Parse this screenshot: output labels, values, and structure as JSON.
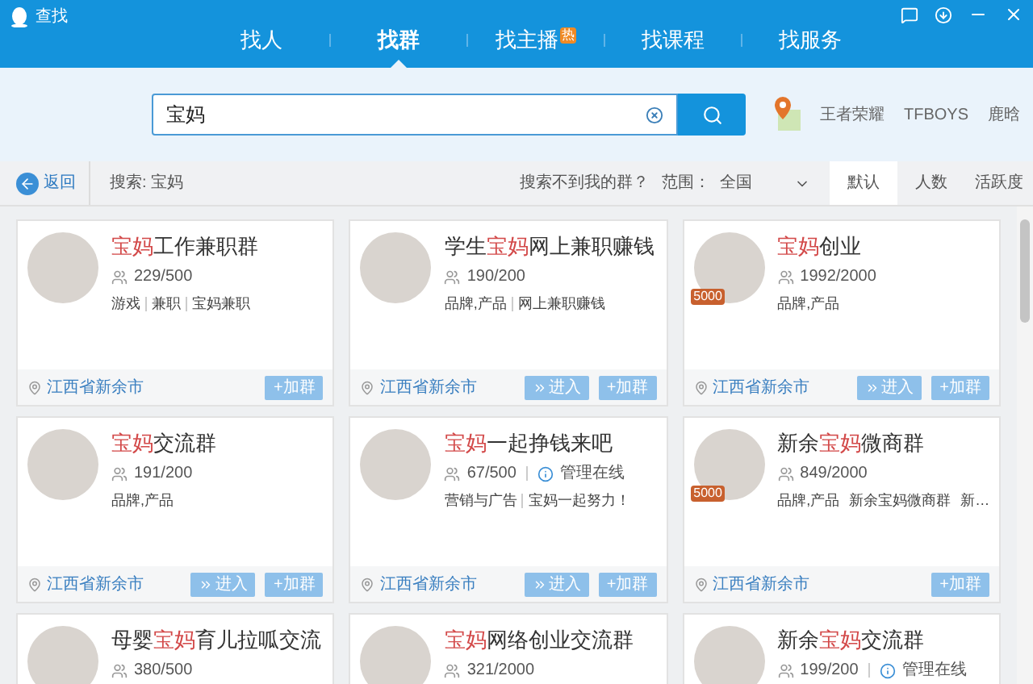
{
  "window": {
    "title": "查找"
  },
  "tabs": [
    {
      "label": "找人",
      "selected": false
    },
    {
      "label": "找群",
      "selected": true
    },
    {
      "label": "找主播",
      "selected": false,
      "badge": "热"
    },
    {
      "label": "找课程",
      "selected": false
    },
    {
      "label": "找服务",
      "selected": false
    }
  ],
  "search": {
    "value": "宝妈"
  },
  "hot_words": [
    "王者荣耀",
    "TFBOYS",
    "鹿晗"
  ],
  "toolbar": {
    "back": "返回",
    "query": "搜索: 宝妈",
    "help_link": "搜索不到我的群？",
    "range_label": "范围：",
    "range_value": "全国",
    "sort_tabs": [
      {
        "label": "默认",
        "selected": true
      },
      {
        "label": "人数",
        "selected": false
      },
      {
        "label": "活跃度",
        "selected": false
      }
    ]
  },
  "groups": [
    {
      "name": [
        {
          "text": "宝妈",
          "highlight": true
        },
        {
          "text": "工作兼职群",
          "highlight": false
        }
      ],
      "members": "229/500",
      "tags": [
        "游戏",
        "兼职",
        "宝妈兼职"
      ],
      "location": "江西省新余市",
      "buttons": [
        {
          "kind": "join",
          "label": "+加群"
        }
      ]
    },
    {
      "name": [
        {
          "text": "学生",
          "highlight": false
        },
        {
          "text": "宝妈",
          "highlight": true
        },
        {
          "text": "网上兼职赚钱",
          "highlight": false
        }
      ],
      "members": "190/200",
      "tags": [
        "品牌,产品",
        "网上兼职赚钱"
      ],
      "location": "江西省新余市",
      "buttons": [
        {
          "kind": "enter",
          "label": "进入"
        },
        {
          "kind": "join",
          "label": "+加群"
        }
      ]
    },
    {
      "name": [
        {
          "text": "宝妈",
          "highlight": true
        },
        {
          "text": "创业",
          "highlight": false
        }
      ],
      "members": "1992/2000",
      "badge": "5000",
      "tags": [
        "品牌,产品"
      ],
      "location": "江西省新余市",
      "buttons": [
        {
          "kind": "enter",
          "label": "进入"
        },
        {
          "kind": "join",
          "label": "+加群"
        }
      ]
    },
    {
      "name": [
        {
          "text": "宝妈",
          "highlight": true
        },
        {
          "text": "交流群",
          "highlight": false
        }
      ],
      "members": "191/200",
      "tags": [
        "品牌,产品"
      ],
      "location": "江西省新余市",
      "buttons": [
        {
          "kind": "enter",
          "label": "进入"
        },
        {
          "kind": "join",
          "label": "+加群"
        }
      ]
    },
    {
      "name": [
        {
          "text": "宝妈",
          "highlight": true
        },
        {
          "text": "一起挣钱来吧",
          "highlight": false
        }
      ],
      "members": "67/500",
      "admin": "管理在线",
      "tags": [
        "营销与广告",
        "宝妈一起努力！"
      ],
      "location": "江西省新余市",
      "buttons": [
        {
          "kind": "enter",
          "label": "进入"
        },
        {
          "kind": "join",
          "label": "+加群"
        }
      ]
    },
    {
      "name": [
        {
          "text": "新余",
          "highlight": false
        },
        {
          "text": "宝妈",
          "highlight": true
        },
        {
          "text": "微商群",
          "highlight": false
        }
      ],
      "members": "849/2000",
      "badge": "5000",
      "tags": [
        "品牌,产品",
        "新余宝妈微商群",
        "新…"
      ],
      "location": "江西省新余市",
      "buttons": [
        {
          "kind": "join",
          "label": "+加群"
        }
      ]
    },
    {
      "name": [
        {
          "text": "母婴",
          "highlight": false
        },
        {
          "text": "宝妈",
          "highlight": true
        },
        {
          "text": "育儿拉呱交流",
          "highlight": false
        }
      ],
      "members": "380/500"
    },
    {
      "name": [
        {
          "text": "宝妈",
          "highlight": true
        },
        {
          "text": "网络创业交流群",
          "highlight": false
        }
      ],
      "members": "321/2000"
    },
    {
      "name": [
        {
          "text": "新余",
          "highlight": false
        },
        {
          "text": "宝妈",
          "highlight": true
        },
        {
          "text": "交流群",
          "highlight": false
        }
      ],
      "members": "199/200",
      "admin": "管理在线"
    }
  ]
}
